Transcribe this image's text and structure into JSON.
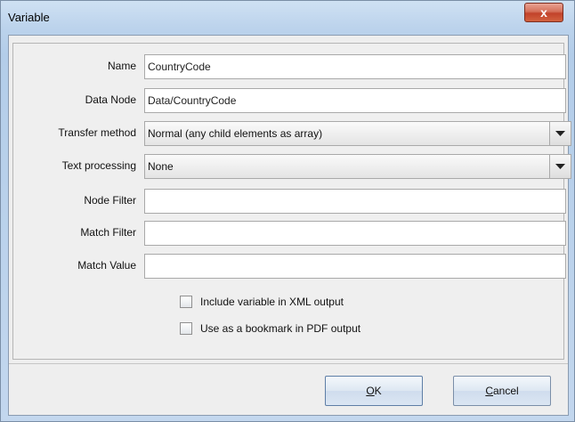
{
  "window": {
    "title": "Variable",
    "close_symbol": "x"
  },
  "form": {
    "name": {
      "label": "Name",
      "value": "CountryCode"
    },
    "data_node": {
      "label": "Data Node",
      "value": "Data/CountryCode"
    },
    "transfer_method": {
      "label": "Transfer method",
      "value": "Normal (any child elements as array)"
    },
    "text_processing": {
      "label": "Text processing",
      "value": "None"
    },
    "node_filter": {
      "label": "Node Filter",
      "value": ""
    },
    "match_filter": {
      "label": "Match Filter",
      "value": ""
    },
    "match_value": {
      "label": "Match Value",
      "value": ""
    },
    "include_xml": {
      "label": "Include variable in XML output",
      "checked": false
    },
    "bookmark_pdf": {
      "label": "Use as a bookmark in PDF output",
      "checked": false
    }
  },
  "buttons": {
    "ok": {
      "mnemonic": "O",
      "rest": "K"
    },
    "cancel": {
      "mnemonic": "C",
      "rest": "ancel"
    }
  },
  "icons": {
    "close": "close-icon",
    "dropdown": "chevron-down-icon"
  }
}
